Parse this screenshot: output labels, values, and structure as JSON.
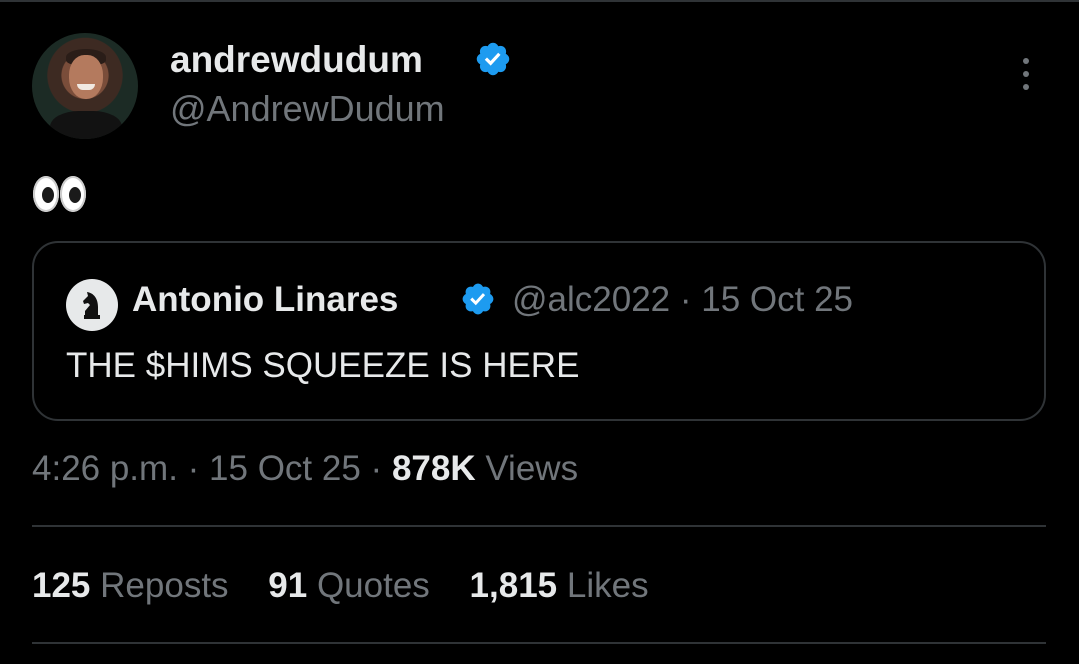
{
  "author": {
    "display_name": "andrewdudum",
    "handle": "@AndrewDudum",
    "verified_icon": "verified-badge-icon",
    "avatar": "profile-photo"
  },
  "tweet": {
    "text_emoji": "👀"
  },
  "quoted_tweet": {
    "display_name": "Antonio Linares",
    "handle": "@alc2022",
    "separator": "·",
    "date": "15 Oct 25",
    "text": "THE $HIMS SQUEEZE IS HERE",
    "avatar_icon": "chess-knight-icon"
  },
  "meta": {
    "time": "4:26 p.m.",
    "sep1": "·",
    "date": "15 Oct 25",
    "sep2": "·",
    "views_count": "878K",
    "views_label": "Views"
  },
  "stats": {
    "reposts_count": "125",
    "reposts_label": "Reposts",
    "quotes_count": "91",
    "quotes_label": "Quotes",
    "likes_count": "1,815",
    "likes_label": "Likes"
  },
  "colors": {
    "background": "#000000",
    "text": "#e7e9ea",
    "muted": "#71767b",
    "border": "#2f3336",
    "verified": "#1d9bf0"
  }
}
